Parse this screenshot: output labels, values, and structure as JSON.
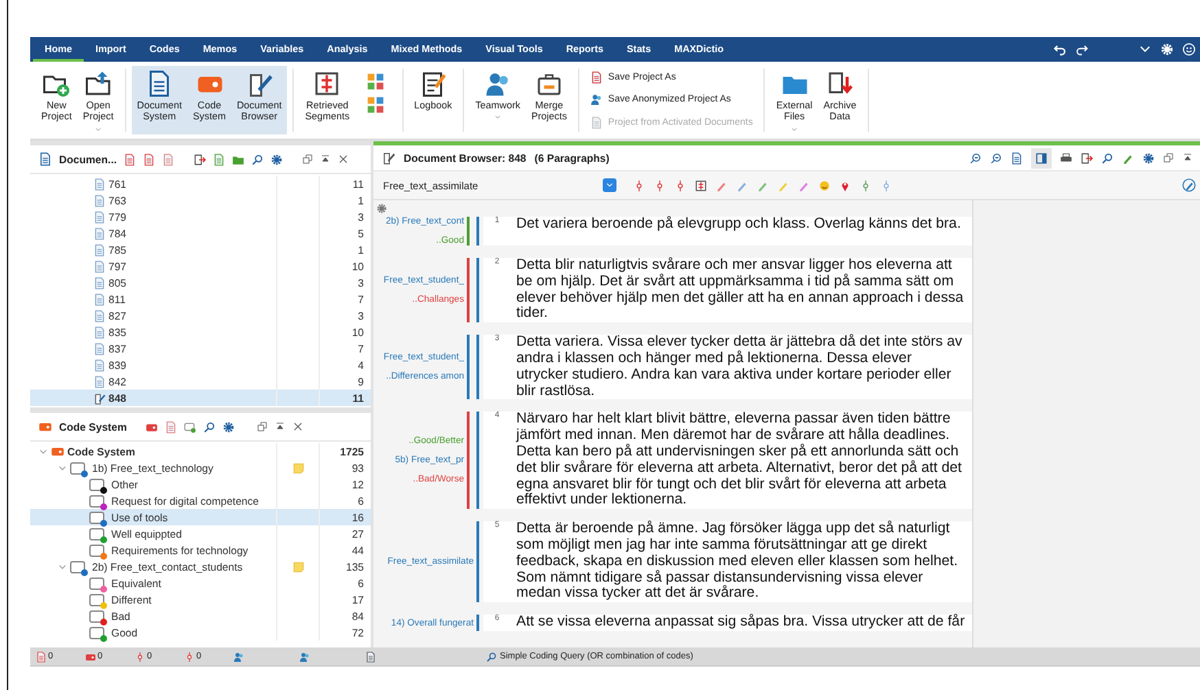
{
  "menu_tabs": [
    {
      "label": "Home",
      "selected": true
    },
    {
      "label": "Import",
      "selected": false
    },
    {
      "label": "Codes",
      "selected": false
    },
    {
      "label": "Memos",
      "selected": false
    },
    {
      "label": "Variables",
      "selected": false
    },
    {
      "label": "Analysis",
      "selected": false
    },
    {
      "label": "Mixed Methods",
      "selected": false
    },
    {
      "label": "Visual Tools",
      "selected": false
    },
    {
      "label": "Reports",
      "selected": false
    },
    {
      "label": "Stats",
      "selected": false
    },
    {
      "label": "MAXDictio",
      "selected": false
    }
  ],
  "ribbon": {
    "groups": [
      {
        "kind": "buttons",
        "items": [
          {
            "label": "New\nProject",
            "selected": false,
            "dropdown": false
          },
          {
            "label": "Open\nProject",
            "selected": false,
            "dropdown": true
          }
        ]
      },
      {
        "kind": "buttons",
        "items": [
          {
            "label": "Document\nSystem",
            "selected": true,
            "dropdown": false
          },
          {
            "label": "Code\nSystem",
            "selected": true,
            "dropdown": false
          },
          {
            "label": "Document\nBrowser",
            "selected": true,
            "dropdown": false
          }
        ]
      },
      {
        "kind": "buttons",
        "items": [
          {
            "label": "Retrieved\nSegments",
            "selected": false,
            "dropdown": false
          },
          {
            "selected": false,
            "dropdown": false
          }
        ]
      },
      {
        "kind": "buttons",
        "items": [
          {
            "label": "Logbook",
            "selected": false,
            "dropdown": false
          }
        ]
      },
      {
        "kind": "buttons",
        "items": [
          {
            "label": "Teamwork",
            "selected": false,
            "dropdown": true
          },
          {
            "label": "Merge\nProjects",
            "selected": false,
            "dropdown": false
          }
        ]
      },
      {
        "kind": "actions",
        "items": [
          {
            "label": "Save Project As",
            "disabled": false
          },
          {
            "label": "Save Anonymized Project As",
            "disabled": false
          },
          {
            "label": "Project from Activated Documents",
            "disabled": true
          }
        ]
      },
      {
        "kind": "buttons",
        "items": [
          {
            "label": "External\nFiles",
            "selected": false,
            "dropdown": true
          },
          {
            "label": "Archive\nData",
            "selected": false,
            "dropdown": false
          }
        ]
      }
    ]
  },
  "document_system": {
    "title": "Documen...",
    "rows": [
      {
        "name": "761",
        "count": "11",
        "selected": false
      },
      {
        "name": "763",
        "count": "1",
        "selected": false
      },
      {
        "name": "779",
        "count": "3",
        "selected": false
      },
      {
        "name": "784",
        "count": "5",
        "selected": false
      },
      {
        "name": "785",
        "count": "1",
        "selected": false
      },
      {
        "name": "797",
        "count": "10",
        "selected": false
      },
      {
        "name": "805",
        "count": "3",
        "selected": false
      },
      {
        "name": "811",
        "count": "7",
        "selected": false
      },
      {
        "name": "827",
        "count": "3",
        "selected": false
      },
      {
        "name": "835",
        "count": "10",
        "selected": false
      },
      {
        "name": "837",
        "count": "7",
        "selected": false
      },
      {
        "name": "839",
        "count": "4",
        "selected": false
      },
      {
        "name": "842",
        "count": "9",
        "selected": false
      },
      {
        "name": "848",
        "count": "11",
        "selected": true
      }
    ]
  },
  "code_system": {
    "title": "Code System",
    "root": {
      "label": "Code System",
      "count": "1725",
      "expanded": true,
      "selected": false,
      "children": [
        {
          "label": "1b) Free_text_technology",
          "count": "93",
          "color": "#1f6fc0",
          "memo": true,
          "expanded": true,
          "selected": false,
          "children": [
            {
              "label": "Other",
              "count": "12",
              "color": "#111111",
              "memo": false,
              "selected": false
            },
            {
              "label": "Request for digital competence",
              "count": "6",
              "color": "#c020c0",
              "memo": false,
              "selected": false
            },
            {
              "label": "Use of tools",
              "count": "16",
              "color": "#1f6fc0",
              "memo": false,
              "selected": true
            },
            {
              "label": "Well equippted",
              "count": "27",
              "color": "#20a030",
              "memo": false,
              "selected": false
            },
            {
              "label": "Requirements for technology",
              "count": "44",
              "color": "#f07818",
              "memo": false,
              "selected": false
            }
          ]
        },
        {
          "label": "2b) Free_text_contact_students",
          "count": "135",
          "color": "#1f6fc0",
          "memo": true,
          "expanded": true,
          "selected": false,
          "children": [
            {
              "label": "Equivalent",
              "count": "6",
              "color": "#f060a0",
              "memo": false,
              "selected": false
            },
            {
              "label": "Different",
              "count": "17",
              "color": "#f0c010",
              "memo": false,
              "selected": false
            },
            {
              "label": "Bad",
              "count": "84",
              "color": "#e02020",
              "memo": false,
              "selected": false
            },
            {
              "label": "Good",
              "count": "72",
              "color": "#20a030",
              "memo": false,
              "selected": false
            }
          ]
        }
      ]
    }
  },
  "doc_browser": {
    "title": "Document Browser: 848",
    "subtitle": "(6 Paragraphs)",
    "code_select": "Free_text_assimilate",
    "paragraphs": [
      {
        "number": "1",
        "text": "Det variera beroende på elevgrupp och klass. Overlag känns det bra.",
        "codes": [
          {
            "label": "2b) Free_text_cont",
            "color": "#2a7ab8"
          },
          {
            "label": "..Good",
            "color": "#4aa030"
          }
        ],
        "brackets": [
          {
            "color": "#4aa030"
          },
          {
            "color": "#2a7ab8"
          }
        ]
      },
      {
        "number": "2",
        "text": "Detta blir naturligtvis svårare och mer ansvar ligger hos eleverna att be om hjälp. Det är svårt att uppmärksamma i tid på samma sätt om elever behöver hjälp men det gäller att ha en annan approach i dessa tider.",
        "codes": [
          {
            "label": "Free_text_student_",
            "color": "#2a7ab8"
          },
          {
            "label": "..Challanges",
            "color": "#e04040"
          }
        ],
        "brackets": [
          {
            "color": "#e04040"
          },
          {
            "color": "#2a7ab8"
          }
        ]
      },
      {
        "number": "3",
        "text": "Detta variera. Vissa elever tycker detta är jättebra då det inte störs av andra i klassen och hänger med på lektionerna. Dessa elever utrycker studiero. Andra kan vara aktiva under kortare perioder eller blir rastlösa.",
        "codes": [
          {
            "label": "Free_text_student_",
            "color": "#2a7ab8"
          },
          {
            "label": "..Differences amon",
            "color": "#2a7ab8"
          }
        ],
        "brackets": [
          {
            "color": "#2a7ab8"
          },
          {
            "color": "#2a7ab8"
          }
        ]
      },
      {
        "number": "4",
        "text": "Närvaro har helt klart blivit bättre, eleverna passar även tiden bättre jämfört med innan. Men däremot har de svårare att hålla deadlines. Detta kan bero på att undervisningen sker på ett annorlunda sätt och det blir svårare för eleverna att arbeta. Alternativt, beror det på att det egna ansvaret blir för tungt och det blir svårt för eleverna att arbeta effektivt under lektionerna.",
        "codes": [
          {
            "label": "..Good/Better",
            "color": "#4aa030"
          },
          {
            "label": "5b) Free_text_pr",
            "color": "#2a7ab8"
          },
          {
            "label": "..Bad/Worse",
            "color": "#e04040"
          }
        ],
        "brackets": [
          {
            "color": "#e04040"
          },
          {
            "color": "#2a7ab8"
          }
        ]
      },
      {
        "number": "5",
        "text": "Detta är beroende på ämne. Jag försöker lägga upp det så naturligt som möjligt men jag har inte samma förutsättningar att ge direkt feedback, skapa en diskussion med eleven eller klassen som helhet. Som nämnt tidigare så passar distansundervisning vissa elever medan vissa tycker att det är svårare.",
        "codes": [
          {
            "label": "Free_text_assimilate",
            "color": "#2a7ab8"
          }
        ],
        "brackets": [
          {
            "color": "#2a7ab8"
          }
        ]
      },
      {
        "number": "6",
        "text": "Att se vissa eleverna anpassat sig såpas bra. Vissa utrycker att de får",
        "codes": [
          {
            "label": "14) Overall fungerat",
            "color": "#2a7ab8"
          }
        ],
        "brackets": [
          {
            "color": "#2a7ab8"
          }
        ]
      }
    ]
  },
  "status_bar": {
    "counts": [
      "0",
      "0",
      "0",
      "0"
    ],
    "query": "Simple Coding Query (OR combination of codes)"
  }
}
